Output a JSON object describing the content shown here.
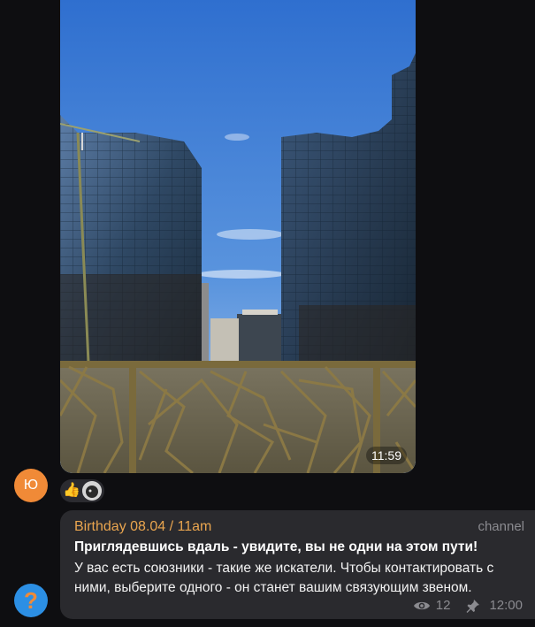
{
  "photo_message": {
    "time": "11:59"
  },
  "sender_avatar": {
    "initial": "Ю",
    "color": "#f08a37"
  },
  "reactions": {
    "emoji": "👍",
    "reactor_avatar": "user-avatar"
  },
  "channel_message": {
    "sender": "Birthday 08.04 / 11am",
    "badge": "channel",
    "bold_text": "Приглядевшись вдаль - увидите, вы не одни на этом пути!",
    "body": "У вас есть союзники - такие же искатели. Чтобы контактировать с ними, выберите одного - он станет вашим связующим звеном.",
    "views": "12",
    "time": "12:00",
    "view_icon": "eye-icon",
    "pin_icon": "pin-icon"
  },
  "bottom_avatar": {
    "glyph": "?",
    "color": "#2c8fe4"
  },
  "colors": {
    "background": "#0e0e11",
    "bubble": "#2a2a2e",
    "sender_name": "#e9a54f",
    "muted": "#8b8b90"
  }
}
